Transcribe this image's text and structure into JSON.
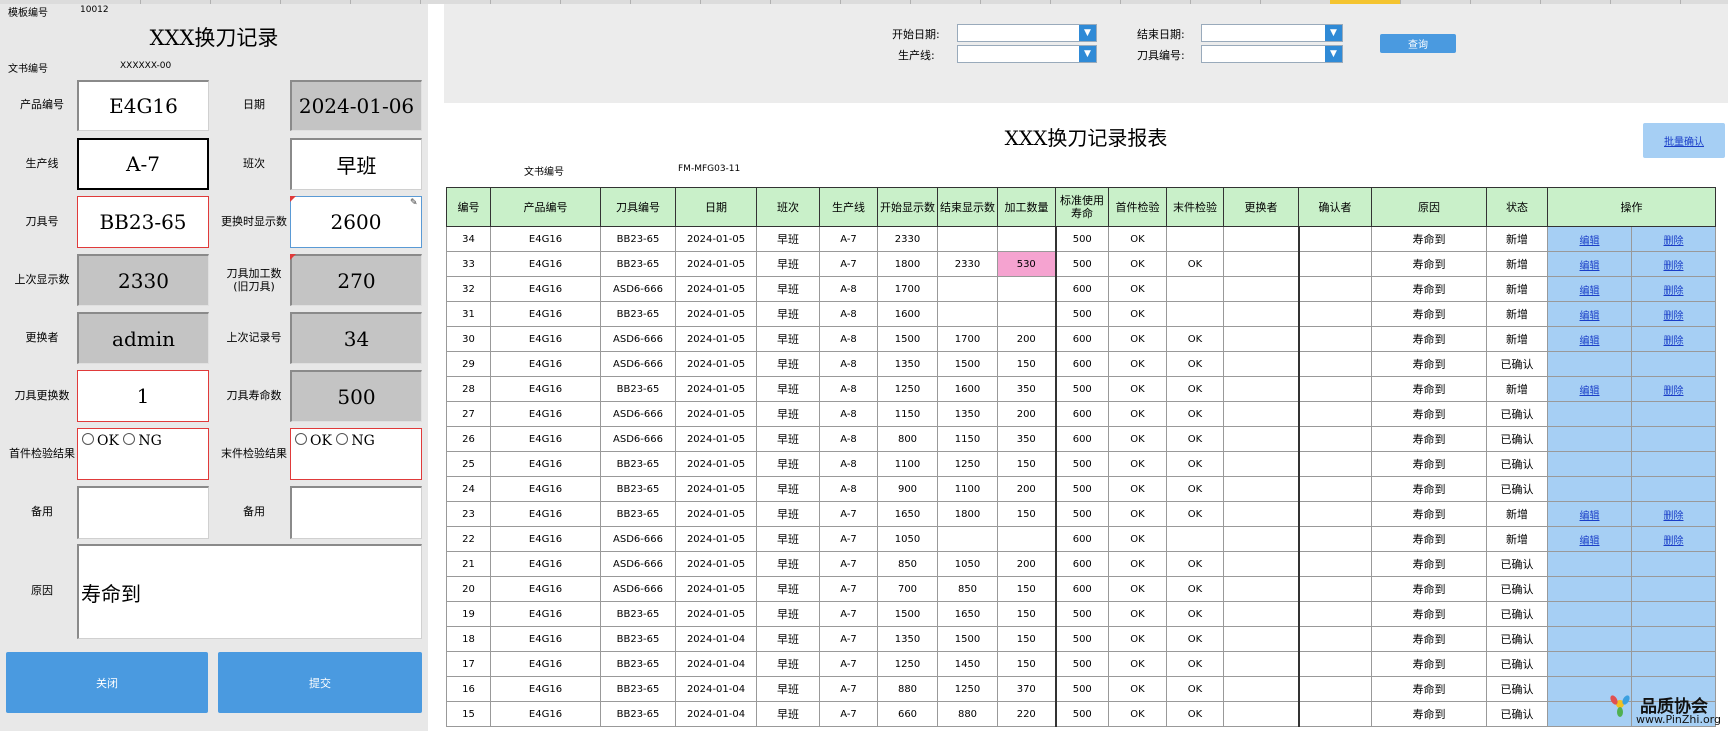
{
  "template_no_label": "模板编号",
  "template_no_value": "10012",
  "form": {
    "title": "XXX换刀记录",
    "doc_no_label": "文书编号",
    "doc_no_value": "XXXXXX-00",
    "product_no_label": "产品编号",
    "product_no_value": "E4G16",
    "date_label": "日期",
    "date_value": "2024-01-06",
    "line_label": "生产线",
    "line_value": "A-7",
    "shift_label": "班次",
    "shift_value": "早班",
    "tool_no_label": "刀具号",
    "tool_no_value": "BB23-65",
    "display_at_change_label": "更换时显示数",
    "display_at_change_value": "2600",
    "last_display_label": "上次显示数",
    "last_display_value": "2330",
    "tool_proc_count_label_1": "刀具加工数",
    "tool_proc_count_label_2": "(旧刀具)",
    "tool_proc_count_value": "270",
    "changer_label": "更换者",
    "changer_value": "admin",
    "last_record_no_label": "上次记录号",
    "last_record_no_value": "34",
    "tool_change_count_label": "刀具更换数",
    "tool_change_count_value": "1",
    "tool_life_label": "刀具寿命数",
    "tool_life_value": "500",
    "first_insp_label": "首件检验结果",
    "last_insp_label": "末件检验结果",
    "opt_ok": "OK",
    "opt_ng": "NG",
    "spare1_label": "备用",
    "spare2_label": "备用",
    "reason_label": "原因",
    "reason_value": "寿命到",
    "close_button": "关闭",
    "submit_button": "提交"
  },
  "filters": {
    "start_date_label": "开始日期:",
    "end_date_label": "结束日期:",
    "line_label": "生产线:",
    "tool_no_label": "刀具编号:",
    "query_button": "查询"
  },
  "report": {
    "title": "XXX换刀记录报表",
    "batch_confirm_button": "批量确认",
    "doc_no_label": "文书编号",
    "doc_no_value": "FM-MFG03-11",
    "columns": [
      "编号",
      "产品编号",
      "刀具编号",
      "日期",
      "班次",
      "生产线",
      "开始显示数",
      "结束显示数",
      "加工数量",
      "标准使用寿命",
      "首件检验",
      "末件检验",
      "更换者",
      "确认者",
      "原因",
      "状态",
      "操作"
    ],
    "edit_label": "编辑",
    "delete_label": "删除",
    "rows": [
      [
        "34",
        "E4G16",
        "BB23-65",
        "2024-01-05",
        "早班",
        "A-7",
        "2330",
        "",
        "",
        "500",
        "OK",
        "",
        "",
        "",
        "寿命到",
        "新增"
      ],
      [
        "33",
        "E4G16",
        "BB23-65",
        "2024-01-05",
        "早班",
        "A-7",
        "1800",
        "2330",
        "530",
        "500",
        "OK",
        "OK",
        "",
        "",
        "寿命到",
        "新增"
      ],
      [
        "32",
        "E4G16",
        "ASD6-666",
        "2024-01-05",
        "早班",
        "A-8",
        "1700",
        "",
        "",
        "600",
        "OK",
        "",
        "",
        "",
        "寿命到",
        "新增"
      ],
      [
        "31",
        "E4G16",
        "BB23-65",
        "2024-01-05",
        "早班",
        "A-8",
        "1600",
        "",
        "",
        "500",
        "OK",
        "",
        "",
        "",
        "寿命到",
        "新增"
      ],
      [
        "30",
        "E4G16",
        "ASD6-666",
        "2024-01-05",
        "早班",
        "A-8",
        "1500",
        "1700",
        "200",
        "600",
        "OK",
        "OK",
        "",
        "",
        "寿命到",
        "新增"
      ],
      [
        "29",
        "E4G16",
        "ASD6-666",
        "2024-01-05",
        "早班",
        "A-8",
        "1350",
        "1500",
        "150",
        "600",
        "OK",
        "OK",
        "",
        "",
        "寿命到",
        "已确认"
      ],
      [
        "28",
        "E4G16",
        "BB23-65",
        "2024-01-05",
        "早班",
        "A-8",
        "1250",
        "1600",
        "350",
        "500",
        "OK",
        "OK",
        "",
        "",
        "寿命到",
        "新增"
      ],
      [
        "27",
        "E4G16",
        "ASD6-666",
        "2024-01-05",
        "早班",
        "A-8",
        "1150",
        "1350",
        "200",
        "600",
        "OK",
        "OK",
        "",
        "",
        "寿命到",
        "已确认"
      ],
      [
        "26",
        "E4G16",
        "ASD6-666",
        "2024-01-05",
        "早班",
        "A-8",
        "800",
        "1150",
        "350",
        "600",
        "OK",
        "OK",
        "",
        "",
        "寿命到",
        "已确认"
      ],
      [
        "25",
        "E4G16",
        "BB23-65",
        "2024-01-05",
        "早班",
        "A-8",
        "1100",
        "1250",
        "150",
        "500",
        "OK",
        "OK",
        "",
        "",
        "寿命到",
        "已确认"
      ],
      [
        "24",
        "E4G16",
        "BB23-65",
        "2024-01-05",
        "早班",
        "A-8",
        "900",
        "1100",
        "200",
        "500",
        "OK",
        "OK",
        "",
        "",
        "寿命到",
        "已确认"
      ],
      [
        "23",
        "E4G16",
        "BB23-65",
        "2024-01-05",
        "早班",
        "A-7",
        "1650",
        "1800",
        "150",
        "500",
        "OK",
        "OK",
        "",
        "",
        "寿命到",
        "新增"
      ],
      [
        "22",
        "E4G16",
        "ASD6-666",
        "2024-01-05",
        "早班",
        "A-7",
        "1050",
        "",
        "",
        "600",
        "OK",
        "",
        "",
        "",
        "寿命到",
        "新增"
      ],
      [
        "21",
        "E4G16",
        "ASD6-666",
        "2024-01-05",
        "早班",
        "A-7",
        "850",
        "1050",
        "200",
        "600",
        "OK",
        "OK",
        "",
        "",
        "寿命到",
        "已确认"
      ],
      [
        "20",
        "E4G16",
        "ASD6-666",
        "2024-01-05",
        "早班",
        "A-7",
        "700",
        "850",
        "150",
        "600",
        "OK",
        "OK",
        "",
        "",
        "寿命到",
        "已确认"
      ],
      [
        "19",
        "E4G16",
        "BB23-65",
        "2024-01-05",
        "早班",
        "A-7",
        "1500",
        "1650",
        "150",
        "500",
        "OK",
        "OK",
        "",
        "",
        "寿命到",
        "已确认"
      ],
      [
        "18",
        "E4G16",
        "BB23-65",
        "2024-01-04",
        "早班",
        "A-7",
        "1350",
        "1500",
        "150",
        "500",
        "OK",
        "OK",
        "",
        "",
        "寿命到",
        "已确认"
      ],
      [
        "17",
        "E4G16",
        "BB23-65",
        "2024-01-04",
        "早班",
        "A-7",
        "1250",
        "1450",
        "150",
        "500",
        "OK",
        "OK",
        "",
        "",
        "寿命到",
        "已确认"
      ],
      [
        "16",
        "E4G16",
        "BB23-65",
        "2024-01-04",
        "早班",
        "A-7",
        "880",
        "1250",
        "370",
        "500",
        "OK",
        "OK",
        "",
        "",
        "寿命到",
        "已确认"
      ],
      [
        "15",
        "E4G16",
        "BB23-65",
        "2024-01-04",
        "早班",
        "A-7",
        "660",
        "880",
        "220",
        "500",
        "OK",
        "OK",
        "",
        "",
        "寿命到",
        "已确认"
      ]
    ]
  },
  "watermark": {
    "name": "品质协会",
    "url": "www.PinZhi.org"
  },
  "colors": {
    "button_blue": "#4a9ae0",
    "header_green": "#c9f0c9",
    "action_blue": "#a6cff4",
    "highlight_pink": "#f5a3d0",
    "required_red": "#e03a3a"
  }
}
